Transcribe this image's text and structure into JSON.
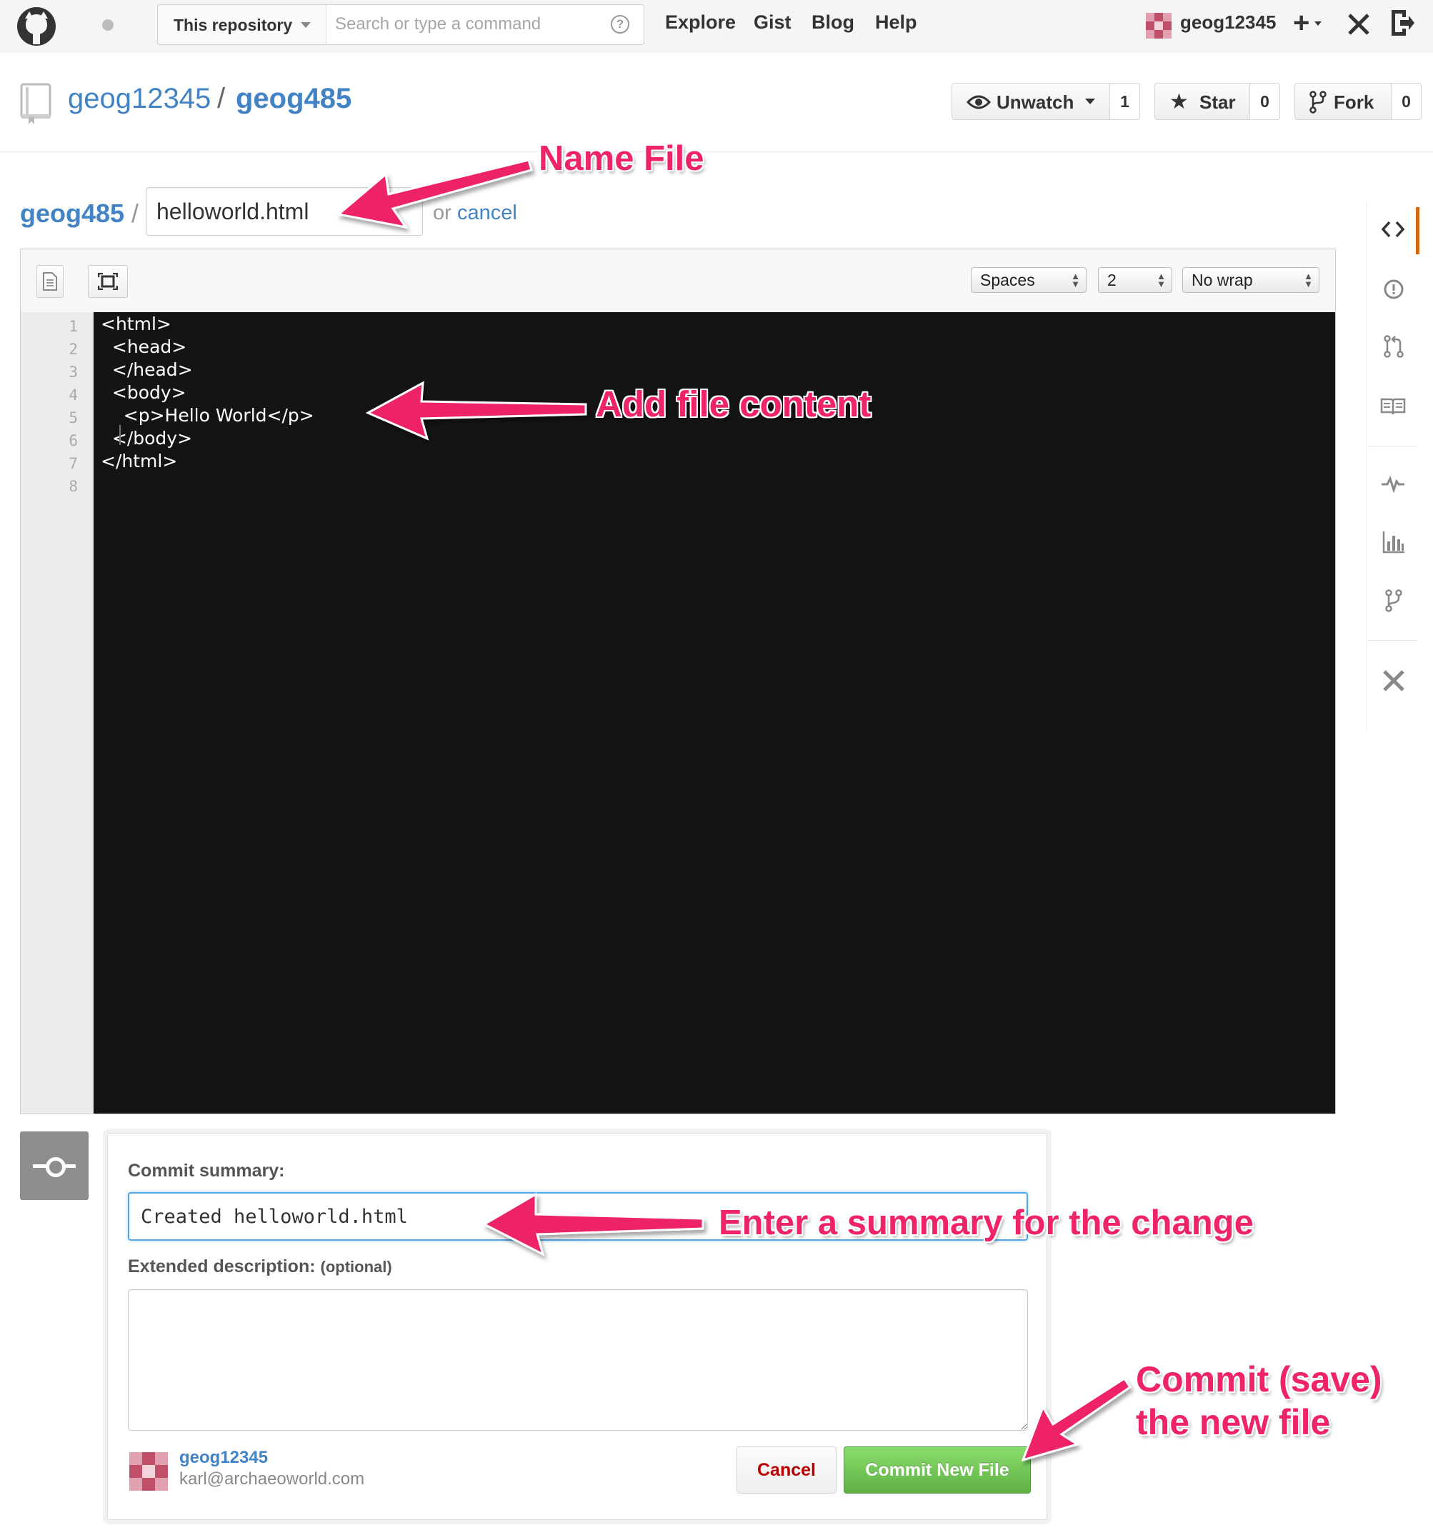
{
  "header": {
    "scope_label": "This repository",
    "search_placeholder": "Search or type a command",
    "help_glyph": "?",
    "nav": [
      "Explore",
      "Gist",
      "Blog",
      "Help"
    ],
    "username": "geog12345",
    "plus_glyph": "+",
    "icons": [
      "github-logo-icon",
      "notification-dot-icon",
      "dropdown-caret-icon",
      "help-icon",
      "avatar",
      "plus-icon",
      "tools-icon",
      "sign-out-icon"
    ]
  },
  "repo": {
    "owner": "geog12345",
    "separator": "/",
    "name": "geog485",
    "unwatch_label": "Unwatch",
    "watch_count": "1",
    "star_label": "Star",
    "star_count": "0",
    "fork_label": "Fork",
    "fork_count": "0"
  },
  "path": {
    "repo": "geog485",
    "separator": "/",
    "filename": "helloworld.html",
    "or_text": "or",
    "cancel_label": "cancel"
  },
  "editor": {
    "indent_mode": "Spaces",
    "indent_size": "2",
    "wrap_mode": "No wrap",
    "line_numbers": [
      "1",
      "2",
      "3",
      "4",
      "5",
      "6",
      "7",
      "8"
    ],
    "lines": [
      "<html>",
      "  <head>",
      "  </head>",
      "  <body>",
      "    <p>Hello World</p>",
      "  </body>",
      "</html>",
      ""
    ]
  },
  "sidebar": {
    "items": [
      "code-icon",
      "issues-icon",
      "pull-requests-icon",
      "wiki-icon",
      "pulse-icon",
      "graphs-icon",
      "network-icon",
      "settings-icon"
    ]
  },
  "commit": {
    "summary_label": "Commit summary:",
    "summary_value": "Created helloworld.html",
    "description_label": "Extended description:",
    "description_optional": "(optional)",
    "author_name": "geog12345",
    "author_email": "karl@archaeoworld.com",
    "cancel_label": "Cancel",
    "commit_label": "Commit New File"
  },
  "annotations": {
    "name_file": "Name File",
    "add_content": "Add file content",
    "enter_summary": "Enter a summary for the change",
    "commit_line1": "Commit (save)",
    "commit_line2": "the new file",
    "color": "#ee2466"
  },
  "colors": {
    "link": "#4183c4",
    "editor_bg": "#141414",
    "commit_green": "#60b044",
    "active_tab": "#d26911"
  }
}
